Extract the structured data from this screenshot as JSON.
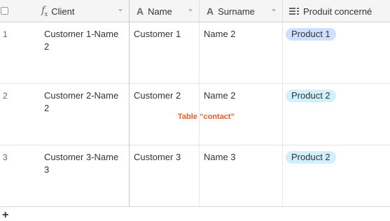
{
  "columns": [
    {
      "name": "",
      "type": "checkbox"
    },
    {
      "name": "Client",
      "icon": "fx-formula-icon"
    },
    {
      "name": "Name",
      "icon": "text-field-icon"
    },
    {
      "name": "Surname",
      "icon": "text-field-icon"
    },
    {
      "name": "Produit concerné",
      "icon": "linked-records-icon"
    }
  ],
  "rows": [
    {
      "num": "1",
      "client_line1": "Customer 1-Name",
      "client_line2": "2",
      "name": "Customer 1",
      "surname": "Name 2",
      "product": "Product 1",
      "product_color": "#cfdfff"
    },
    {
      "num": "2",
      "client_line1": "Customer 2-Name",
      "client_line2": "2",
      "name": "Customer 2",
      "surname": "Name 2",
      "product": "Product 2",
      "product_color": "#d0f0fd"
    },
    {
      "num": "3",
      "client_line1": "Customer 3-Name",
      "client_line2": "3",
      "name": "Customer 3",
      "surname": "Name 3",
      "product": "Product 2",
      "product_color": "#d0f0fd"
    }
  ],
  "annotation": "Table “contact”",
  "add_row_label": "+",
  "colors": {
    "header_bg": "#f5f5f5",
    "annotation": "#f05a24"
  }
}
